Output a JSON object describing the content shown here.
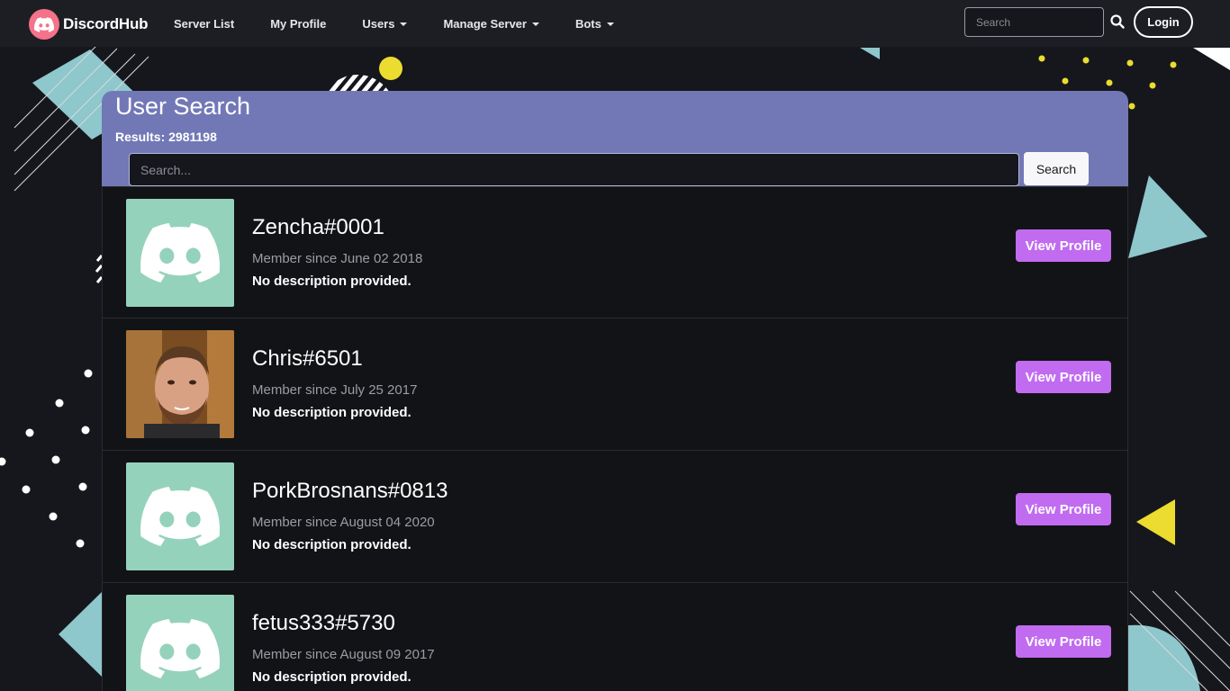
{
  "nav": {
    "brand": "DiscordHub",
    "links": [
      {
        "label": "Server List",
        "dropdown": false
      },
      {
        "label": "My Profile",
        "dropdown": false
      },
      {
        "label": "Users",
        "dropdown": true
      },
      {
        "label": "Manage Server",
        "dropdown": true
      },
      {
        "label": "Bots",
        "dropdown": true
      }
    ],
    "search_placeholder": "Search",
    "login_label": "Login"
  },
  "search": {
    "title": "User Search",
    "results_label": "Results:",
    "results_count": "2981198",
    "placeholder": "Search...",
    "button_label": "Search"
  },
  "users": [
    {
      "name": "Zencha#0001",
      "member_since": "Member since June 02 2018",
      "description": "No description provided.",
      "avatar": "discord-default-icon",
      "button": "View Profile"
    },
    {
      "name": "Chris#6501",
      "member_since": "Member since July 25 2017",
      "description": "No description provided.",
      "avatar": "photo-avatar",
      "button": "View Profile"
    },
    {
      "name": "PorkBrosnans#0813",
      "member_since": "Member since August 04 2020",
      "description": "No description provided.",
      "avatar": "discord-default-icon",
      "button": "View Profile"
    },
    {
      "name": "fetus333#5730",
      "member_since": "Member since August 09 2017",
      "description": "No description provided.",
      "avatar": "discord-default-icon",
      "button": "View Profile"
    }
  ],
  "colors": {
    "background": "#16171c",
    "navbar": "#1d1e24",
    "search_card": "#7278b6",
    "avatar_bg": "#95d2bb",
    "view_button": "#c16bf0",
    "brand_logo": "#f4728a"
  }
}
